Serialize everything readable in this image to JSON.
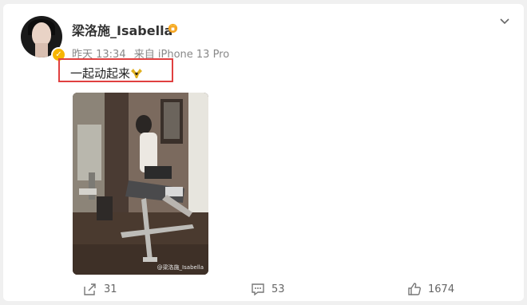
{
  "post": {
    "author": "梁洛施_Isabella",
    "time": "昨天 13:34",
    "source": "来自 iPhone 13 Pro",
    "text": "一起动起来",
    "image_watermark": "@梁洛施_Isabella"
  },
  "actions": {
    "repost_count": "31",
    "comment_count": "53",
    "like_count": "1674"
  },
  "colors": {
    "highlight_box": "#e04040",
    "verified_badge": "#f7b500"
  }
}
